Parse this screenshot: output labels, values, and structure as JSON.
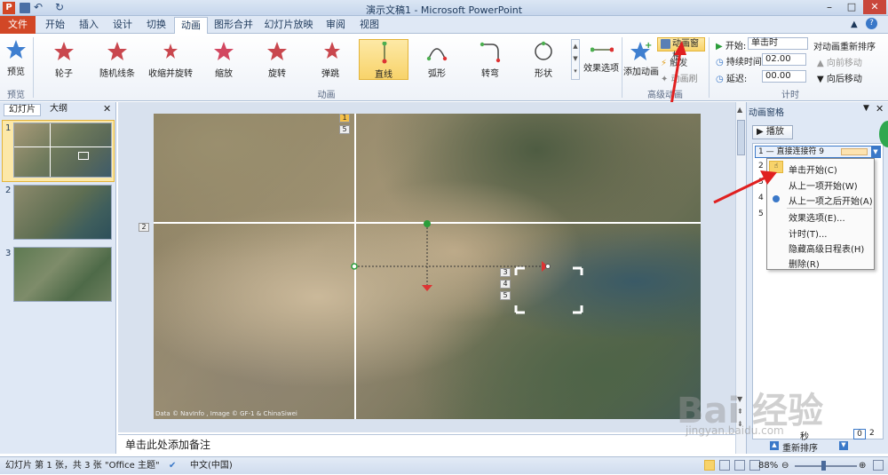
{
  "titlebar": {
    "title": "演示文稿1 - Microsoft PowerPoint"
  },
  "tabs": [
    "开始",
    "插入",
    "设计",
    "切换",
    "动画",
    "图形合并",
    "幻灯片放映",
    "审阅",
    "视图"
  ],
  "file_tab": "文件",
  "ribbon": {
    "preview_label": "预览",
    "preview_group": "预览",
    "effects": [
      {
        "label": "轮子"
      },
      {
        "label": "随机线条"
      },
      {
        "label": "收缩并旋转"
      },
      {
        "label": "缩放"
      },
      {
        "label": "旋转"
      },
      {
        "label": "弹跳"
      },
      {
        "label": "直线"
      },
      {
        "label": "弧形"
      },
      {
        "label": "转弯"
      },
      {
        "label": "形状"
      }
    ],
    "effect_options": "效果选项",
    "animation_group": "动画",
    "add_animation": "添加动画",
    "anim_pane_btn": "动画窗格",
    "trigger": "触发",
    "anim_painter": "动画刷",
    "advanced_group": "高级动画",
    "start_label": "开始:",
    "start_value": "单击时",
    "duration_label": "持续时间:",
    "duration_value": "02.00",
    "delay_label": "延迟:",
    "delay_value": "00.00",
    "reorder_title": "对动画重新排序",
    "move_earlier": "向前移动",
    "move_later": "向后移动",
    "timing_group": "计时"
  },
  "leftpane": {
    "tab_slides": "幻灯片",
    "tab_outline": "大纲",
    "nums": [
      "1",
      "2",
      "3"
    ]
  },
  "slide": {
    "attribution": "Data © NavInfo , Image © GF-1 & ChinaSiwei",
    "tags": [
      "1",
      "5",
      "2",
      "3",
      "4",
      "5"
    ]
  },
  "notes": "单击此处添加备注",
  "animpane": {
    "title": "动画窗格",
    "play": "播放",
    "item1": "1 — 直接连接符 9",
    "row_nums": [
      "2",
      "3",
      "4",
      "5"
    ],
    "menu": [
      "单击开始(C)",
      "从上一项开始(W)",
      "从上一项之后开始(A)",
      "效果选项(E)...",
      "计时(T)...",
      "隐藏高级日程表(H)",
      "删除(R)"
    ],
    "seconds": "秒",
    "page_a": "0",
    "page_b": "2",
    "reorder": "重新排序"
  },
  "statusbar": {
    "slide_info": "幻灯片 第 1 张，共 3 张",
    "theme": "\"Office 主题\"",
    "lang": "中文(中国)",
    "zoom": "88%"
  },
  "watermark": {
    "text": "Bai 经验",
    "url": "jingyan.baidu.com"
  }
}
